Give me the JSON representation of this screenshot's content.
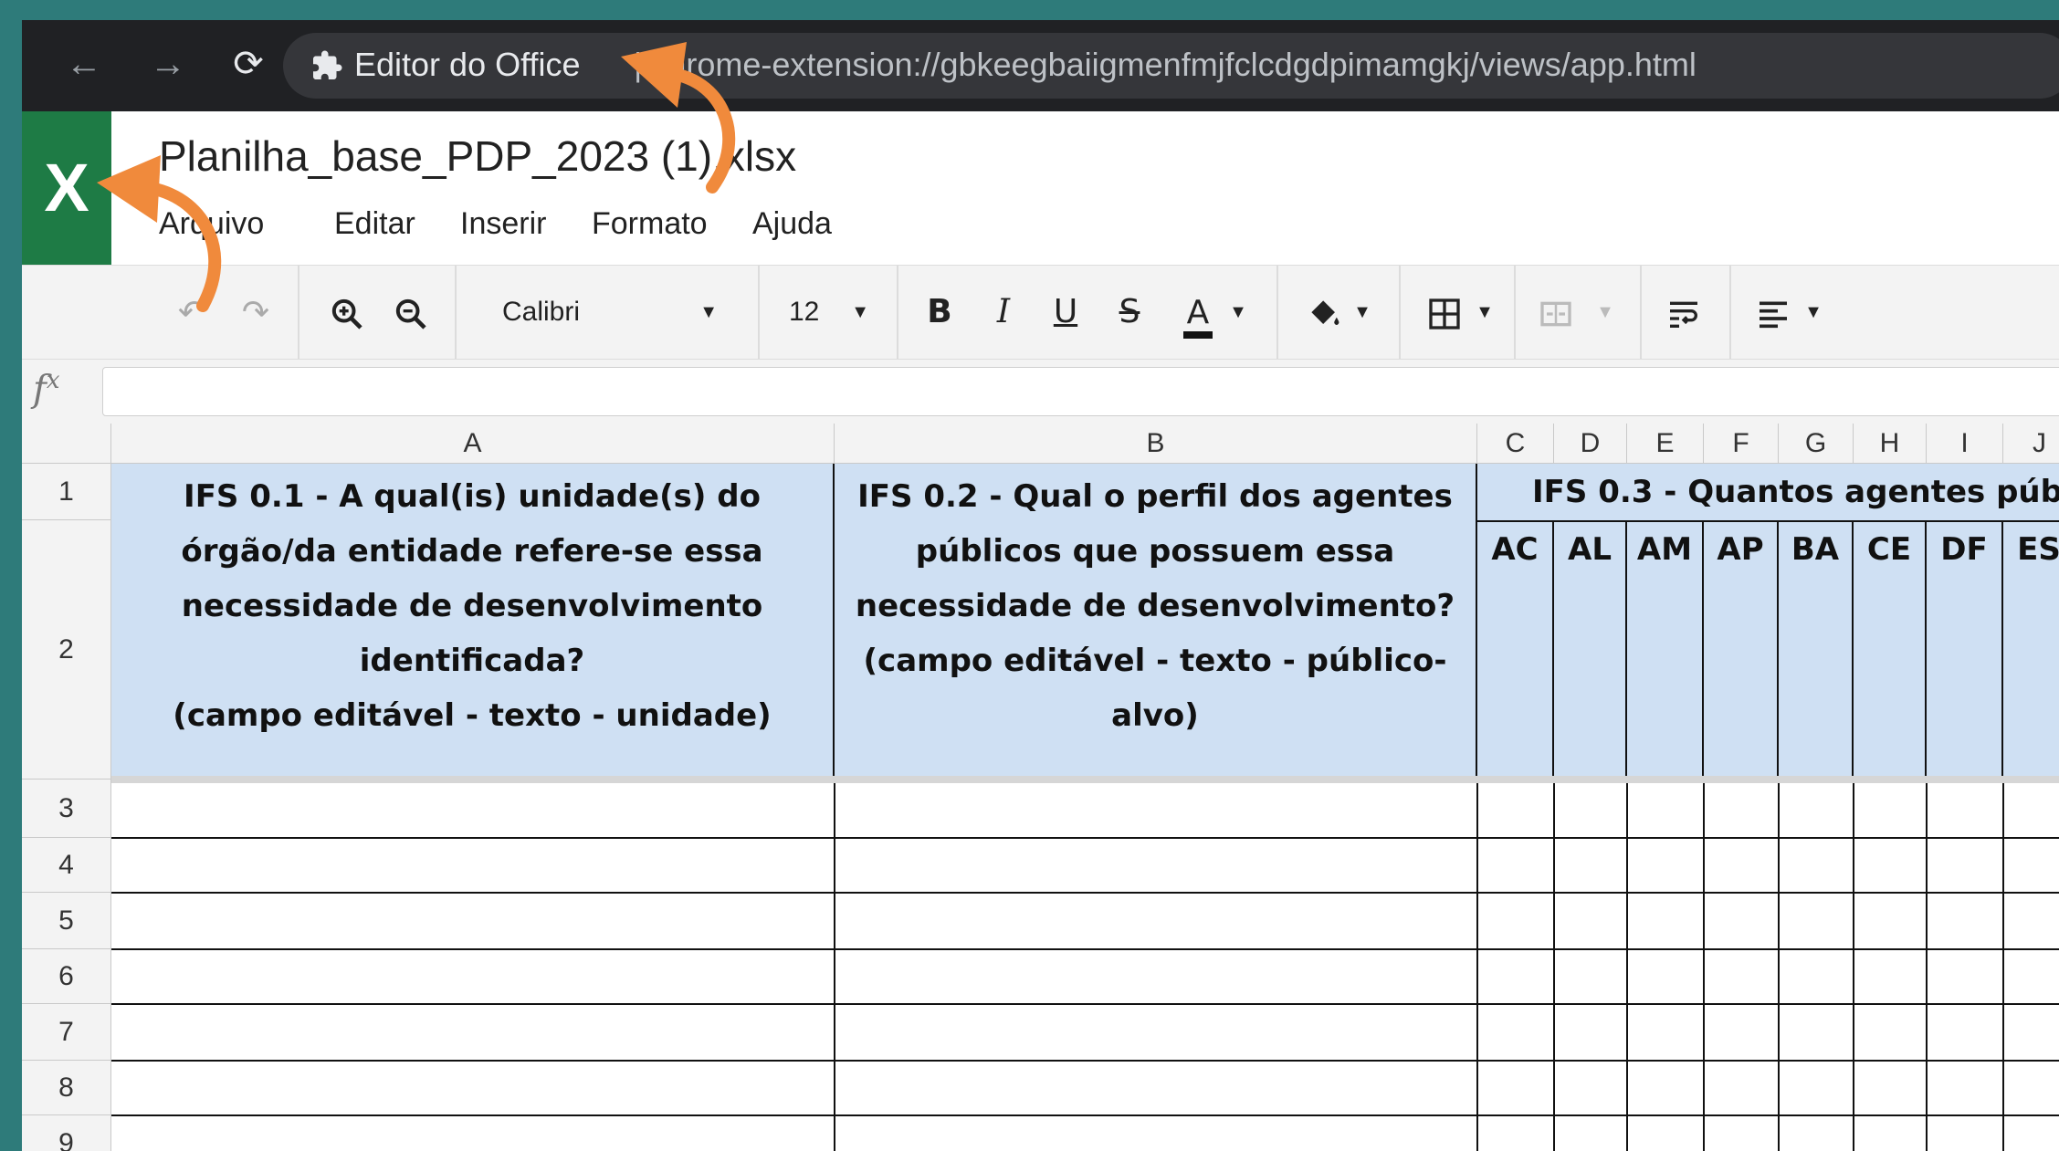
{
  "browser": {
    "tab_title": "Editor do Office",
    "url_text": "| chrome-extension://gbkeegbaiigmenfmjfclcdgdpimamgkj/views/app.html"
  },
  "app": {
    "logo_letter": "X",
    "file_name": "Planilha_base_PDP_2023 (1).xlsx",
    "menus": [
      "Arquivo",
      "Editar",
      "Inserir",
      "Formato",
      "Ajuda"
    ]
  },
  "toolbar": {
    "font_name": "Calibri",
    "font_size": "12",
    "bold": "B",
    "italic": "I",
    "underline": "U",
    "strikethrough": "S",
    "font_color": "A"
  },
  "formula": {
    "fx_label": "fx",
    "value": ""
  },
  "sheet": {
    "columns": [
      "A",
      "B",
      "C",
      "D",
      "E",
      "F",
      "G",
      "H",
      "I",
      "J"
    ],
    "rows": [
      "1",
      "2",
      "3",
      "4",
      "5",
      "6",
      "7",
      "8",
      "9"
    ],
    "cell_a1": "IFS 0.1 - A qual(is) unidade(s) do\nórgão/da entidade refere-se essa\nnecessidade de desenvolvimento\nidentificada?\n(campo editável - texto - unidade)",
    "cell_b1": "IFS 0.2 - Qual o perfil dos agentes\npúblicos que possuem essa\nnecessidade de desenvolvimento?\n(campo editável - texto - público-\nalvo)",
    "cell_c1": "IFS 0.3 - Quantos agentes púb",
    "ufs": [
      "AC",
      "AL",
      "AM",
      "AP",
      "BA",
      "CE",
      "DF",
      "ES"
    ]
  },
  "colors": {
    "header_fill": "#cfe0f3",
    "excel_green": "#1e7b45",
    "annotation_arrow": "#f08a3c"
  }
}
